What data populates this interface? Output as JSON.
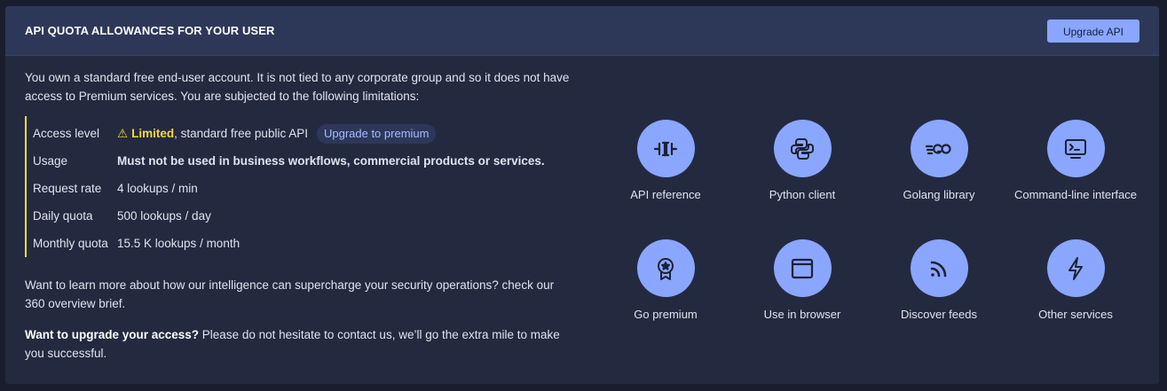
{
  "header": {
    "title": "API QUOTA ALLOWANCES FOR YOUR USER",
    "upgrade_button": "Upgrade API"
  },
  "intro": "You own a standard free end-user account. It is not tied to any corporate group and so it does not have access to Premium services. You are subjected to the following limitations:",
  "limits": {
    "access_level": {
      "label": "Access level",
      "warning_icon": "⚠",
      "value_bold": "Limited",
      "value_rest": ", standard free public API",
      "chip": "Upgrade to premium"
    },
    "usage": {
      "label": "Usage",
      "value": "Must not be used in business workflows, commercial products or services."
    },
    "request_rate": {
      "label": "Request rate",
      "value": "4 lookups / min"
    },
    "daily_quota": {
      "label": "Daily quota",
      "value": "500 lookups / day"
    },
    "monthly_quota": {
      "label": "Monthly quota",
      "value": "15.5 K lookups / month"
    }
  },
  "learn_more": "Want to learn more about how our intelligence can supercharge your security operations? check our 360 overview brief.",
  "upgrade_prompt": {
    "bold": "Want to upgrade your access?",
    "rest": " Please do not hesitate to contact us, we’ll go the extra mile to make you successful."
  },
  "tiles": [
    {
      "label": "API reference",
      "icon": "api-icon"
    },
    {
      "label": "Python client",
      "icon": "python-icon"
    },
    {
      "label": "Golang library",
      "icon": "golang-icon"
    },
    {
      "label": "Command-line interface",
      "icon": "terminal-icon"
    },
    {
      "label": "Go premium",
      "icon": "premium-badge-icon"
    },
    {
      "label": "Use in browser",
      "icon": "browser-icon"
    },
    {
      "label": "Discover feeds",
      "icon": "rss-icon"
    },
    {
      "label": "Other services",
      "icon": "lightning-icon"
    }
  ],
  "colors": {
    "accent": "#8aa6ff",
    "warning": "#f3d93a",
    "card_background": "#232a40",
    "header_background": "#2d3859"
  }
}
